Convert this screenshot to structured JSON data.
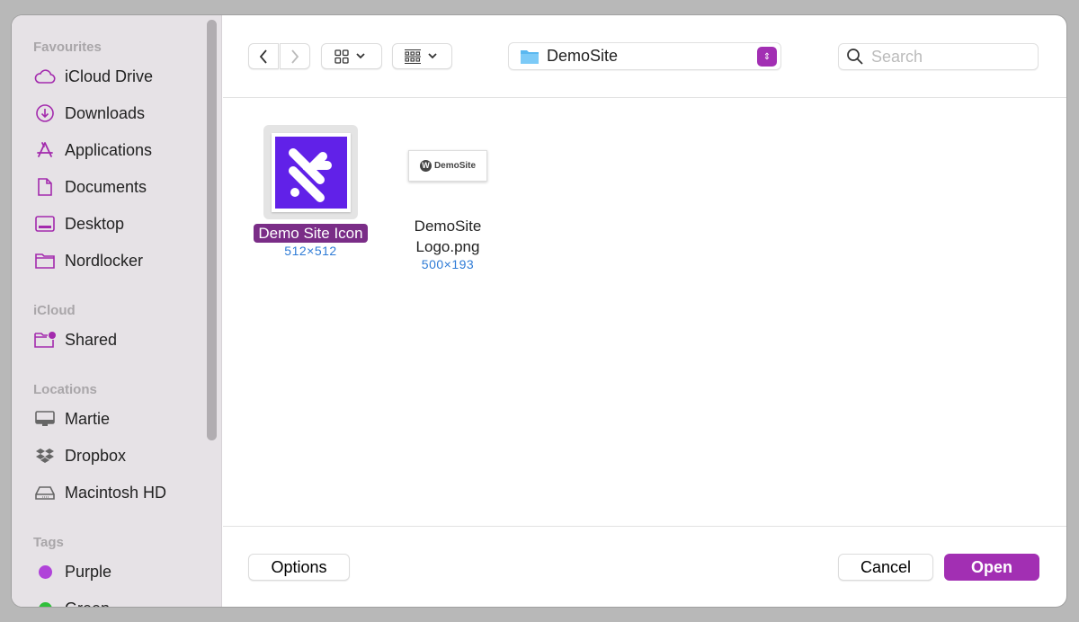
{
  "sidebar": {
    "sections": {
      "favourites": {
        "title": "Favourites",
        "items": [
          {
            "label": "iCloud Drive",
            "icon": "cloud-icon"
          },
          {
            "label": "Downloads",
            "icon": "download-circle-icon"
          },
          {
            "label": "Applications",
            "icon": "applications-icon"
          },
          {
            "label": "Documents",
            "icon": "document-icon"
          },
          {
            "label": "Desktop",
            "icon": "desktop-icon"
          },
          {
            "label": "Nordlocker",
            "icon": "folder-icon"
          }
        ]
      },
      "icloud": {
        "title": "iCloud",
        "items": [
          {
            "label": "Shared",
            "icon": "shared-folder-icon"
          }
        ]
      },
      "locations": {
        "title": "Locations",
        "items": [
          {
            "label": "Martie",
            "icon": "monitor-icon"
          },
          {
            "label": "Dropbox",
            "icon": "dropbox-icon"
          },
          {
            "label": "Macintosh HD",
            "icon": "hard-drive-icon"
          }
        ]
      },
      "tags": {
        "title": "Tags",
        "items": [
          {
            "label": "Purple",
            "color": "#b043d9"
          },
          {
            "label": "Green",
            "color": "#2fbf3a"
          }
        ]
      }
    }
  },
  "toolbar": {
    "current_folder": "DemoSite",
    "search_placeholder": "Search"
  },
  "files": [
    {
      "name": "Demo Site Icon",
      "dimensions": "512×512",
      "selected": true
    },
    {
      "name_line1": "DemoSite",
      "name_line2": "Logo.png",
      "dimensions": "500×193",
      "thumb_text": "DemoSite"
    }
  ],
  "footer": {
    "options": "Options",
    "cancel": "Cancel",
    "open": "Open"
  },
  "colors": {
    "accent": "#a22fb3",
    "selection": "#7a2d87",
    "icon_bg": "#6121e8",
    "sidebar_icon": "#a32aad"
  }
}
